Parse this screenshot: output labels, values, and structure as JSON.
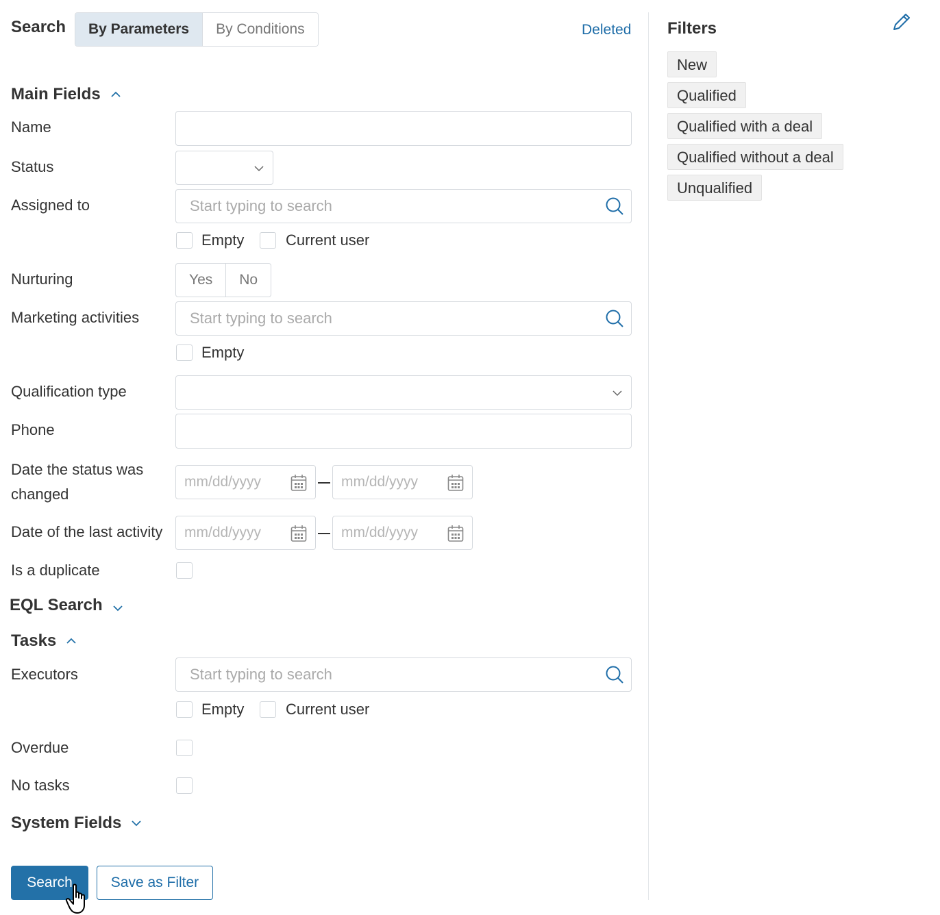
{
  "header": {
    "title": "Search",
    "tabs": [
      {
        "label": "By Parameters",
        "active": true
      },
      {
        "label": "By Conditions",
        "active": false
      }
    ],
    "deleted_link": "Deleted"
  },
  "sections": {
    "main_fields": "Main Fields",
    "eql_search": "EQL Search",
    "tasks": "Tasks",
    "system_fields": "System Fields"
  },
  "fields": {
    "name": {
      "label": "Name",
      "value": ""
    },
    "status": {
      "label": "Status",
      "value": ""
    },
    "assigned_to": {
      "label": "Assigned to",
      "placeholder": "Start typing to search",
      "empty_label": "Empty",
      "current_user_label": "Current user"
    },
    "nurturing": {
      "label": "Nurturing",
      "options": [
        "Yes",
        "No"
      ]
    },
    "marketing_activities": {
      "label": "Marketing activities",
      "placeholder": "Start typing to search",
      "empty_label": "Empty"
    },
    "qualification_type": {
      "label": "Qualification type",
      "value": ""
    },
    "phone": {
      "label": "Phone",
      "value": ""
    },
    "date_status_changed": {
      "label_line1": "Date the status was",
      "label_line2": "changed",
      "from_placeholder": "mm/dd/yyyy",
      "to_placeholder": "mm/dd/yyyy"
    },
    "date_last_activity": {
      "label": "Date of the last activity",
      "from_placeholder": "mm/dd/yyyy",
      "to_placeholder": "mm/dd/yyyy"
    },
    "is_duplicate": {
      "label": "Is a duplicate"
    }
  },
  "tasks": {
    "executors": {
      "label": "Executors",
      "placeholder": "Start typing to search",
      "empty_label": "Empty",
      "current_user_label": "Current user"
    },
    "overdue": {
      "label": "Overdue"
    },
    "no_tasks": {
      "label": "No tasks"
    }
  },
  "actions": {
    "search": "Search",
    "save_as_filter": "Save as Filter"
  },
  "filters": {
    "title": "Filters",
    "items": [
      "New",
      "Qualified",
      "Qualified with a deal",
      "Qualified without a deal",
      "Unqualified"
    ]
  },
  "colors": {
    "accent": "#2371a8",
    "link": "#1e6da8",
    "tab_active_bg": "#dfe8f0",
    "tag_bg": "#f1f1f1"
  },
  "icons": {
    "search": "search-icon",
    "calendar": "calendar-icon",
    "chevron": "chevron-icon",
    "edit": "pencil-icon",
    "cursor": "hand-cursor-icon"
  }
}
